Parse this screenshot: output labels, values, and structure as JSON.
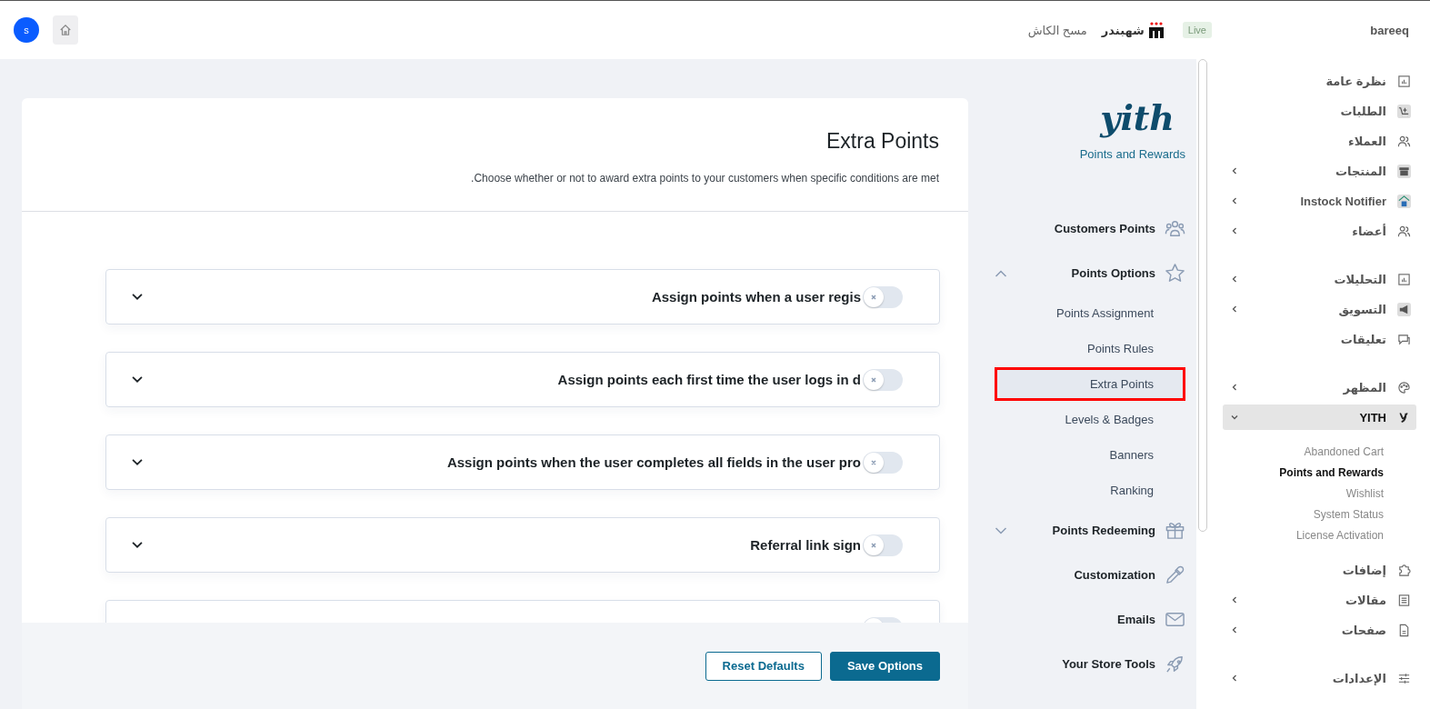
{
  "topbar": {
    "site": "bareeq",
    "live_badge": "Live",
    "brand": "شهبندر",
    "clear_cache": "مسح الكاش",
    "avatar": "s"
  },
  "sidebar": {
    "groups": [
      [
        {
          "label": "نظرة عامة",
          "has_submenu": false,
          "selected": false
        },
        {
          "label": "الطلبات",
          "has_submenu": false,
          "selected": false
        },
        {
          "label": "العملاء",
          "has_submenu": false,
          "selected": false
        },
        {
          "label": "المنتجات",
          "has_submenu": true,
          "expanded": false,
          "selected": false
        },
        {
          "label": "Instock Notifier",
          "has_submenu": true,
          "expanded": false,
          "selected": false
        },
        {
          "label": "أعضاء",
          "has_submenu": true,
          "expanded": false,
          "selected": false
        }
      ],
      [
        {
          "label": "التحليلات",
          "has_submenu": true,
          "expanded": false,
          "selected": false
        },
        {
          "label": "التسويق",
          "has_submenu": true,
          "expanded": false,
          "selected": false
        },
        {
          "label": "تعليقات",
          "has_submenu": false,
          "selected": false
        }
      ],
      [
        {
          "label": "المظهر",
          "has_submenu": true,
          "expanded": false,
          "selected": false
        },
        {
          "label": "YITH",
          "has_submenu": true,
          "expanded": true,
          "selected": true,
          "children": [
            {
              "label": "Abandoned Cart",
              "selected": false
            },
            {
              "label": "Points and Rewards",
              "selected": true
            },
            {
              "label": "Wishlist",
              "selected": false
            },
            {
              "label": "System Status",
              "selected": false
            },
            {
              "label": "License Activation",
              "selected": false
            }
          ]
        },
        {
          "label": "إضافات",
          "has_submenu": false,
          "selected": false
        },
        {
          "label": "مقالات",
          "has_submenu": true,
          "expanded": false,
          "selected": false
        },
        {
          "label": "صفحات",
          "has_submenu": true,
          "expanded": false,
          "selected": false
        }
      ],
      [
        {
          "label": "الإعدادات",
          "has_submenu": true,
          "expanded": false,
          "selected": false
        }
      ]
    ]
  },
  "plugin_nav": {
    "logo": "yith",
    "subtitle": "Points and Rewards",
    "items": [
      {
        "label": "Customers Points",
        "expandable": false
      },
      {
        "label": "Points Options",
        "expandable": true,
        "expanded": true,
        "children": [
          {
            "label": "Points Assignment",
            "selected": false
          },
          {
            "label": "Points Rules",
            "selected": false
          },
          {
            "label": "Extra Points",
            "selected": true
          },
          {
            "label": "Levels & Badges",
            "selected": false
          },
          {
            "label": "Banners",
            "selected": false
          },
          {
            "label": "Ranking",
            "selected": false
          }
        ]
      },
      {
        "label": "Points Redeeming",
        "expandable": true,
        "expanded": false
      },
      {
        "label": "Customization",
        "expandable": false
      },
      {
        "label": "Emails",
        "expandable": false
      },
      {
        "label": "Your Store Tools",
        "expandable": false
      }
    ]
  },
  "content": {
    "title": "Extra Points",
    "description": "Choose whether or not to award extra points to your customers when specific conditions are met.",
    "rows": [
      {
        "title": "Assign points when a user regis",
        "enabled": false
      },
      {
        "title": "Assign points each first time the user logs in d",
        "enabled": false
      },
      {
        "title": "Assign points when the user completes all fields in the user pro",
        "enabled": false
      },
      {
        "title": "Referral link sign",
        "enabled": false
      },
      {
        "enabled": false
      }
    ],
    "buttons": {
      "reset": "Reset Defaults",
      "save": "Save Options"
    }
  }
}
